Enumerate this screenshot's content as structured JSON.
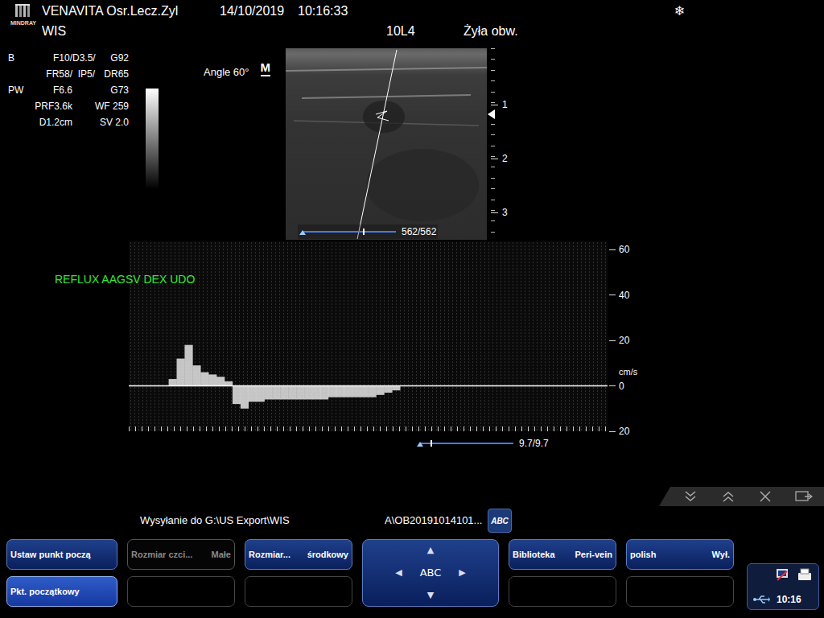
{
  "header": {
    "brand": "MINDRAY",
    "facility": "VENAVITA Osr.Lecz.Zyl",
    "date": "14/10/2019",
    "time": "10:16:33",
    "exam": "WIS",
    "probe": "10L4",
    "preset": "Żyła obw.",
    "freeze": "❄"
  },
  "params": [
    [
      "B",
      "F10/",
      "D3.5/",
      "G92"
    ],
    [
      "",
      "FR58/",
      "IP5/",
      "DR65"
    ],
    [
      "PW",
      "F6.6",
      "",
      "G73"
    ],
    [
      "",
      "PRF3.6k",
      "WF 259"
    ],
    [
      "",
      "D1.2cm",
      "SV 2.0"
    ]
  ],
  "angle": "Angle 60°",
  "mode_mark": "M",
  "image": {
    "counter": "562/562",
    "depth_ticks": [
      "1",
      "2",
      "3"
    ]
  },
  "spectrum": {
    "label": "REFLUX AAGSV DEX UDO",
    "unit": "cm/s",
    "min": -20,
    "max": 60,
    "ticks": [
      {
        "text": "60",
        "value": 60
      },
      {
        "text": "40",
        "value": 40
      },
      {
        "text": "20",
        "value": 20
      },
      {
        "text": "0",
        "value": 0
      },
      {
        "text": "20",
        "value": -20
      }
    ],
    "values": [
      0,
      0,
      0,
      0,
      0,
      3,
      12,
      18,
      9,
      6,
      5,
      4,
      2,
      -8,
      -10,
      -7,
      -7,
      -6,
      -6,
      -6,
      -6,
      -6,
      -6,
      -6,
      -6,
      -5,
      -5,
      -5,
      -5,
      -5,
      -5,
      -4,
      -3,
      -2,
      0,
      0,
      0,
      0,
      0,
      0,
      0,
      0,
      0,
      0,
      0,
      0,
      0,
      0,
      0,
      0,
      0,
      0,
      0,
      0,
      0,
      0,
      0,
      0,
      0,
      0
    ],
    "scale_reading": "9.7/9.7"
  },
  "export": {
    "destination": "Wysyłanie do G:\\US Export\\WIS",
    "file": "A\\OB20191014101...",
    "abc": "ABC"
  },
  "softkey_columns": [
    {
      "top": {
        "label": "Ustaw punkt począ",
        "value": "",
        "selected": false,
        "disabled": false
      },
      "bottom": {
        "label": "Pkt. początkowy",
        "value": "",
        "selected": true,
        "disabled": false
      }
    },
    {
      "top": {
        "label": "Rozmiar czci...",
        "value": "Małe",
        "selected": false,
        "disabled": true
      },
      "bottom": {
        "label": "",
        "value": "",
        "selected": false,
        "disabled": false
      }
    },
    {
      "top": {
        "label": "Rozmiar...",
        "value": "środkowy",
        "selected": false,
        "disabled": false
      },
      "bottom": {
        "label": "",
        "value": "",
        "selected": false,
        "disabled": false
      }
    },
    {
      "top": {
        "label": "Biblioteka",
        "value": "Peri-vein",
        "selected": false,
        "disabled": false
      },
      "bottom": {
        "label": "",
        "value": "",
        "selected": false,
        "disabled": false
      }
    },
    {
      "top": {
        "label": "polish",
        "value": "Wył.",
        "selected": false,
        "disabled": false
      },
      "bottom": {
        "label": "",
        "value": "",
        "selected": false,
        "disabled": false
      }
    }
  ],
  "pad": {
    "up": "▲",
    "down": "▼",
    "left": "◀",
    "right": "▶",
    "center": "ABC"
  },
  "status": {
    "time": "10:16"
  }
}
